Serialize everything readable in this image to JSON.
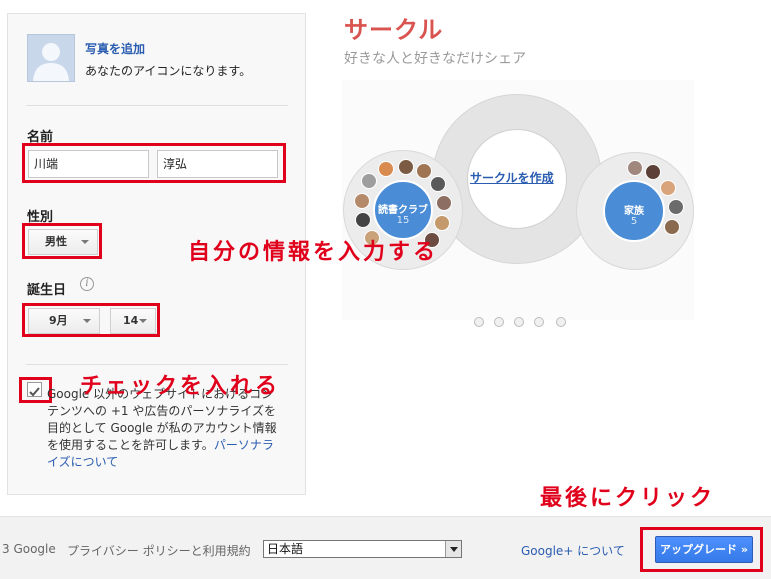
{
  "profile": {
    "add_photo": "写真を追加",
    "icon_note": "あなたのアイコンになります。"
  },
  "name": {
    "label": "名前",
    "last_name": "川端",
    "first_name": "淳弘"
  },
  "gender": {
    "label": "性別",
    "value": "男性"
  },
  "birthday": {
    "label": "誕生日",
    "month": "9月",
    "day": "14"
  },
  "consent": {
    "checked": true,
    "text": "Google 以外のウェブサイトにおけるコンテンツへの +1 や広告のパーソナライズを目的として Google が私のアカウント情報を使用することを許可します。",
    "link": "パーソナライズについて"
  },
  "promo": {
    "title": "サークル",
    "subtitle": "好きな人と好きなだけシェア",
    "create_circle": "サークルを作成",
    "circle_left_name": "読書クラブ",
    "circle_left_count": "15",
    "circle_right_name": "家族",
    "circle_right_count": "5"
  },
  "annotations": {
    "enter_info": "自分の情報を入力する",
    "check": "チェックを入れる",
    "click_last": "最後にクリック"
  },
  "footer": {
    "copyright": "3 Google",
    "privacy": "プライバシー ポリシーと利用規約",
    "language": "日本語",
    "about": "Google+ について",
    "upgrade": "アップグレード »"
  },
  "colors": {
    "annotation_red": "#e0001b",
    "link_blue": "#2a5db0",
    "button_blue": "#4d90fe",
    "title_red": "#d9534f"
  }
}
